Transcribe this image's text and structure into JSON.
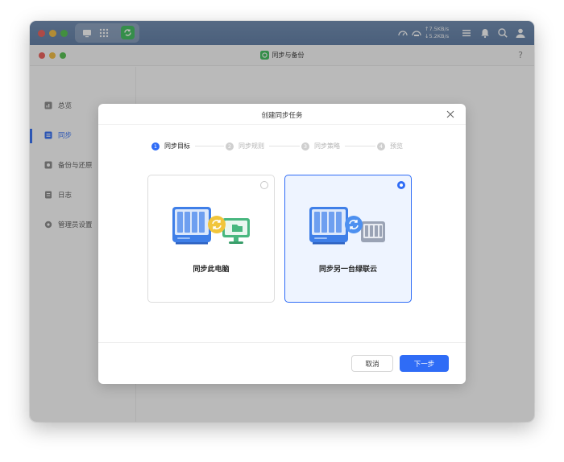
{
  "topbar": {
    "upload_speed": "↑7.5KB/s",
    "download_speed": "↓5.2KB/s"
  },
  "app": {
    "title": "同步与备份",
    "help": "?"
  },
  "sidebar": {
    "items": [
      {
        "label": "总览",
        "icon": "overview-icon"
      },
      {
        "label": "同步",
        "icon": "sync-icon",
        "active": true
      },
      {
        "label": "备份与还原",
        "icon": "backup-icon"
      },
      {
        "label": "日志",
        "icon": "log-icon"
      },
      {
        "label": "管理员设置",
        "icon": "gear-icon"
      }
    ]
  },
  "modal": {
    "title": "创建同步任务",
    "steps": [
      {
        "num": "1",
        "label": "同步目标"
      },
      {
        "num": "2",
        "label": "同步规则"
      },
      {
        "num": "3",
        "label": "同步策略"
      },
      {
        "num": "4",
        "label": "预览"
      }
    ],
    "current_step": 1,
    "options": [
      {
        "label": "同步此电脑",
        "selected": false
      },
      {
        "label": "同步另一台绿联云",
        "selected": true
      }
    ],
    "cancel_label": "取消",
    "next_label": "下一步"
  },
  "colors": {
    "accent": "#2f6cf6",
    "topbar": "#5f7ea8"
  }
}
